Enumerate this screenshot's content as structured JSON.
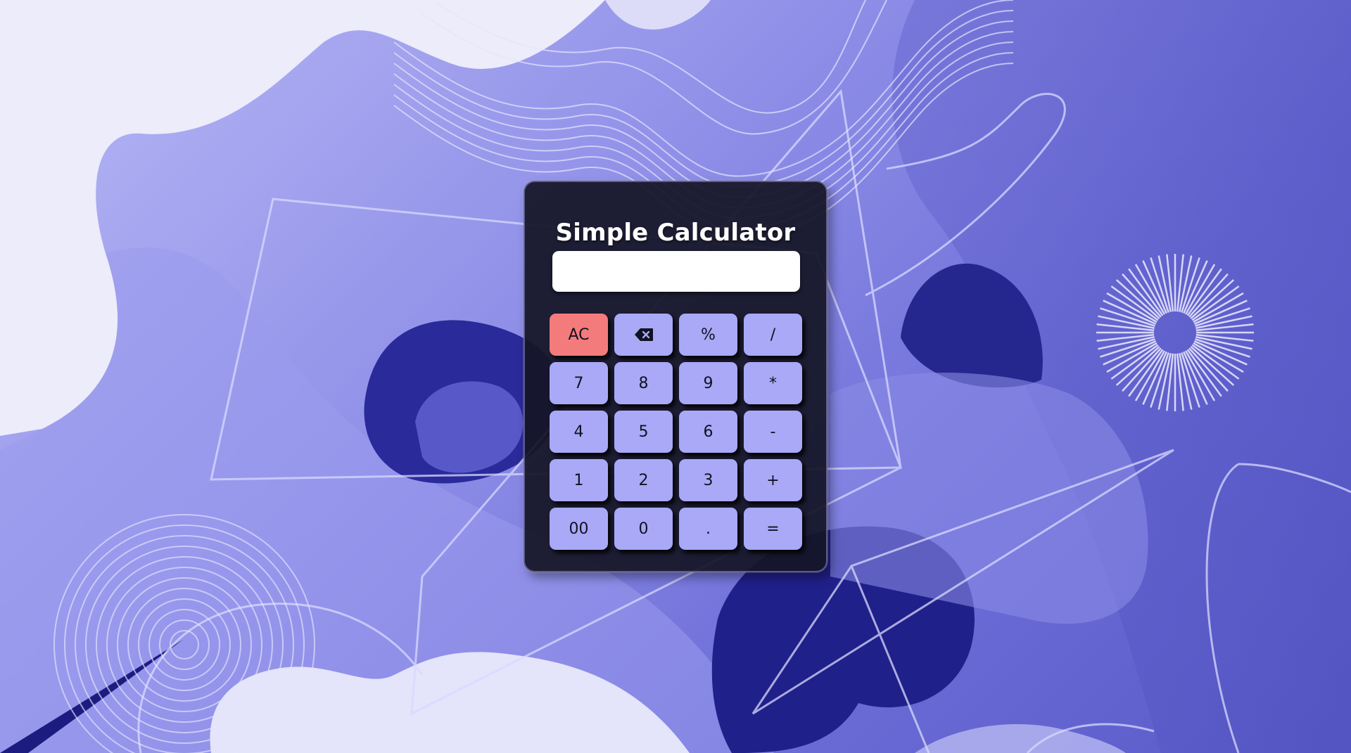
{
  "calculator": {
    "title": "Simple Calculator",
    "display_value": "",
    "keys": [
      {
        "label": "AC",
        "name": "clear-button",
        "kind": "clear"
      },
      {
        "label": "",
        "name": "backspace-button",
        "kind": "backspace",
        "icon": "backspace-icon"
      },
      {
        "label": "%",
        "name": "percent-button",
        "kind": "op"
      },
      {
        "label": "/",
        "name": "divide-button",
        "kind": "op"
      },
      {
        "label": "7",
        "name": "digit-7-button",
        "kind": "digit"
      },
      {
        "label": "8",
        "name": "digit-8-button",
        "kind": "digit"
      },
      {
        "label": "9",
        "name": "digit-9-button",
        "kind": "digit"
      },
      {
        "label": "*",
        "name": "multiply-button",
        "kind": "op"
      },
      {
        "label": "4",
        "name": "digit-4-button",
        "kind": "digit"
      },
      {
        "label": "5",
        "name": "digit-5-button",
        "kind": "digit"
      },
      {
        "label": "6",
        "name": "digit-6-button",
        "kind": "digit"
      },
      {
        "label": "-",
        "name": "subtract-button",
        "kind": "op"
      },
      {
        "label": "1",
        "name": "digit-1-button",
        "kind": "digit"
      },
      {
        "label": "2",
        "name": "digit-2-button",
        "kind": "digit"
      },
      {
        "label": "3",
        "name": "digit-3-button",
        "kind": "digit"
      },
      {
        "label": "+",
        "name": "add-button",
        "kind": "op"
      },
      {
        "label": "00",
        "name": "double-zero-button",
        "kind": "digit"
      },
      {
        "label": "0",
        "name": "digit-0-button",
        "kind": "digit"
      },
      {
        "label": ".",
        "name": "decimal-button",
        "kind": "op"
      },
      {
        "label": "=",
        "name": "equals-button",
        "kind": "equals"
      }
    ]
  },
  "colors": {
    "panel": "#14142a",
    "key": "#a9a9f7",
    "clear_key": "#f47b7b",
    "background_accent": "#6d6dd8",
    "background_dark": "#1e1e82"
  }
}
